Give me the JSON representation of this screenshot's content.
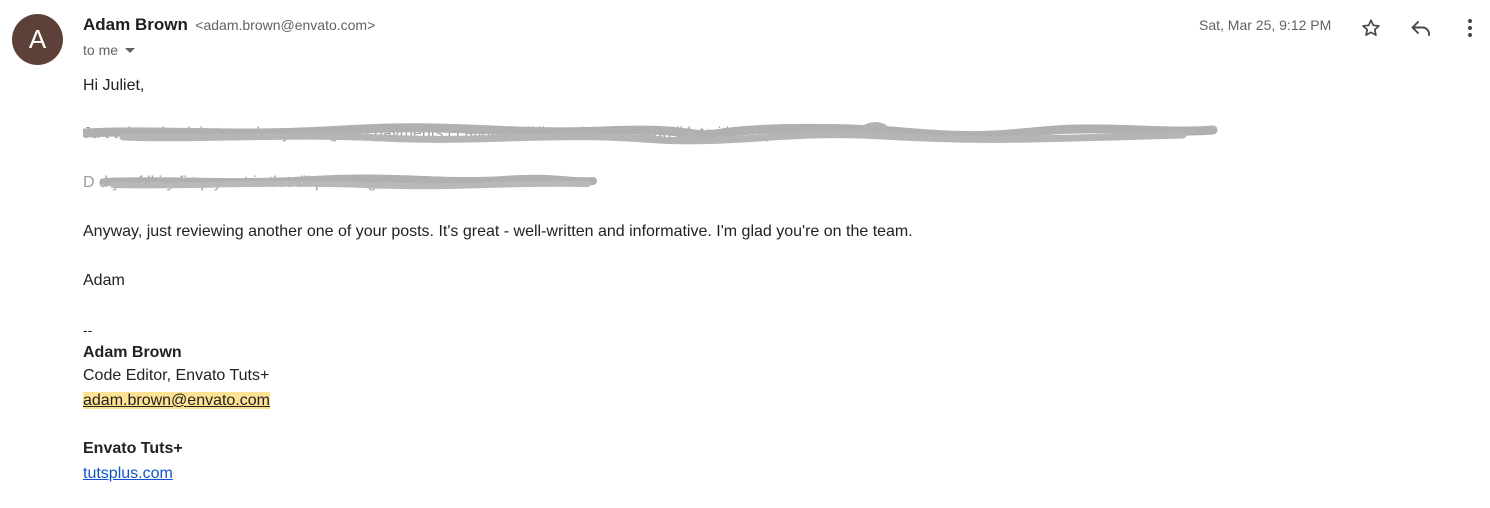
{
  "sender": {
    "avatar_letter": "A",
    "avatar_color": "#5d4037",
    "name": "Adam Brown",
    "email": "<adam.brown@envato.com>",
    "recipient_label": "to me",
    "date": "Sat, Mar 25, 9:12 PM"
  },
  "actions": {
    "star_icon": "star-outline-icon",
    "reply_icon": "reply-icon",
    "more_icon": "more-vert-icon"
  },
  "body": {
    "greeting": "Hi Juliet,",
    "redacted_line_1": "Ju   t  t d to       check in to mak    e   y   u   t     ing and payments     i   f     ation  stuff       ll    t  t  t th t   t   I    saw   an   li k   to   ith      e      d     pl     rk     to   t   t    t?",
    "redacted_line_2": "D  d y         e    f    ll     i     y           fi  t       p  y  m     t   is  th  t  till  p  e ndi g?",
    "review_line": "Anyway, just reviewing another one of your posts. It's great - well-written and informative. I'm glad you're on the team.",
    "signoff": "Adam"
  },
  "signature": {
    "separator": "--",
    "name": "Adam Brown",
    "title": "Code Editor, Envato Tuts+",
    "email": "adam.brown@envato.com",
    "company": "Envato Tuts+",
    "website": "tutsplus.com"
  }
}
